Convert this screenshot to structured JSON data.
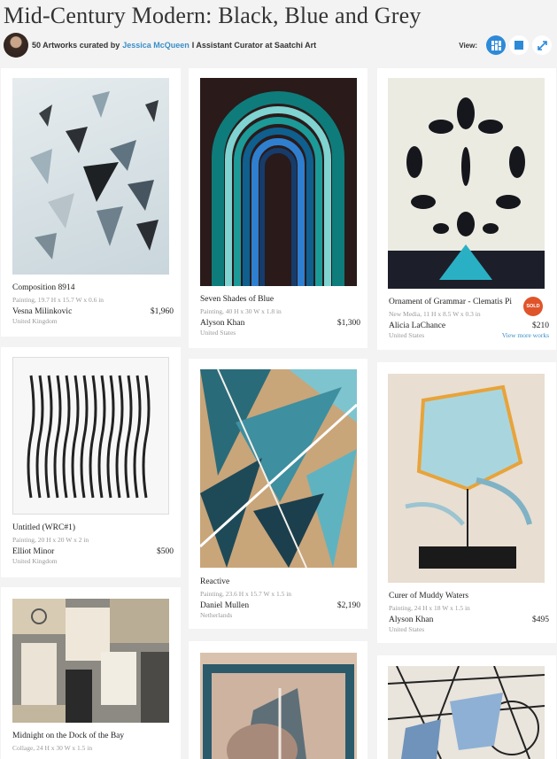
{
  "page": {
    "title": "Mid-Century Modern: Black, Blue and Grey",
    "curator_count_text": "50 Artworks curated by",
    "curator_name": "Jessica McQueen",
    "curator_role": "I Assistant Curator at Saatchi Art",
    "view_label": "View:"
  },
  "view_icons": [
    "grid-view-icon",
    "single-view-icon",
    "expand-icon"
  ],
  "colors": {
    "accent": "#2d8ad8",
    "link": "#3a8fc7",
    "sold": "#e0542a"
  },
  "artworks": [
    {
      "title": "Composition 8914",
      "details": "Painting, 19.7 H x 15.7 W x 0.6 in",
      "artist": "Vesna Milinkovic",
      "country": "United Kingdom",
      "price": "$1,960"
    },
    {
      "title": "Seven Shades of Blue",
      "details": "Painting, 40 H x 30 W x 1.8 in",
      "artist": "Alyson Khan",
      "country": "United States",
      "price": "$1,300"
    },
    {
      "title": "Ornament of Grammar - Clematis Pi",
      "details": "New Media, 11 H x 8.5 W x 0.3 in",
      "artist": "Alicia LaChance",
      "country": "United States",
      "price": "$210",
      "sold_label": "SOLD",
      "more_label": "View more works"
    },
    {
      "title": "Untitled (WRC#1)",
      "details": "Painting, 20 H x 20 W x 2 in",
      "artist": "Elliot Minor",
      "country": "United Kingdom",
      "price": "$500"
    },
    {
      "title": "Reactive",
      "details": "Painting, 23.6 H x 15.7 W x 1.5 in",
      "artist": "Daniel Mullen",
      "country": "Netherlands",
      "price": "$2,190"
    },
    {
      "title": "Curer of Muddy Waters",
      "details": "Painting, 24 H x 18 W x 1.5 in",
      "artist": "Alyson Khan",
      "country": "United States",
      "price": "$495"
    },
    {
      "title": "Midnight on the Dock of the Bay",
      "details": "Collage, 24 H x 30 W x 1.5 in"
    }
  ]
}
